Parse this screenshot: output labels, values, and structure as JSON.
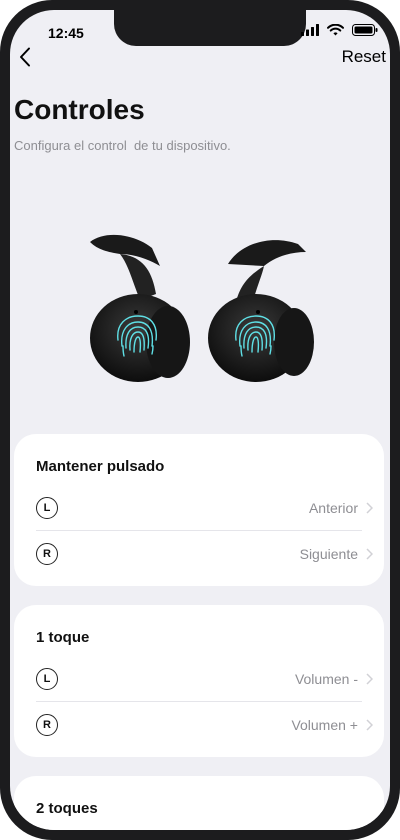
{
  "status_bar": {
    "time": "12:45"
  },
  "nav": {
    "reset_label": "Reset"
  },
  "page": {
    "title": "Controles",
    "subtitle": "Configura el control  de tu dispositivo."
  },
  "sections": [
    {
      "title": "Mantener pulsado",
      "rows": [
        {
          "side": "L",
          "value": "Anterior"
        },
        {
          "side": "R",
          "value": "Siguiente"
        }
      ]
    },
    {
      "title": "1 toque",
      "rows": [
        {
          "side": "L",
          "value": "Volumen -"
        },
        {
          "side": "R",
          "value": "Volumen +"
        }
      ]
    },
    {
      "title": "2 toques",
      "rows": []
    }
  ],
  "icons": {
    "back": "chevron-left-icon",
    "signal": "cellular-signal-icon",
    "wifi": "wifi-icon",
    "battery": "battery-icon",
    "row_arrow": "chevron-right-icon",
    "touch": "fingerprint-icon"
  },
  "colors": {
    "background": "#efeff4",
    "card": "#ffffff",
    "secondary_text": "#8e8e93",
    "touch_accent": "#5fe0e6"
  }
}
